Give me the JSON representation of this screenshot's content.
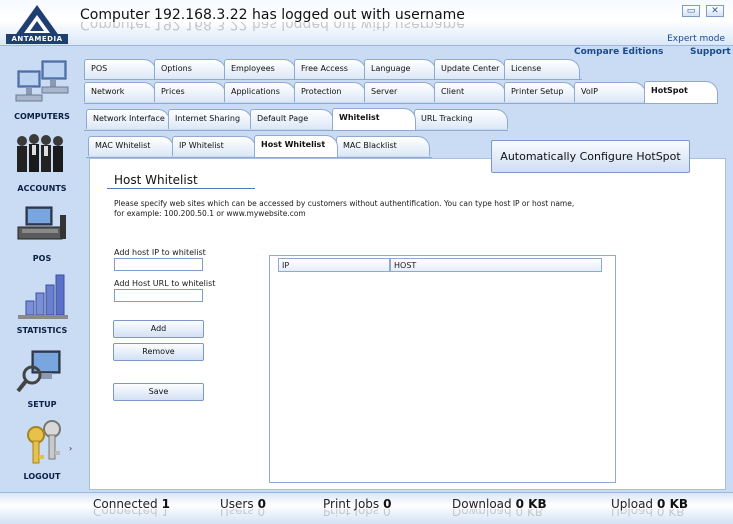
{
  "window": {
    "title": "Computer 192.168.3.22 has logged out with username",
    "logo_text": "ANTAMEDIA",
    "expert_mode": "Expert mode",
    "minimize_icon": "minimize-icon",
    "close_icon": "close-icon"
  },
  "top_links": {
    "compare": "Compare Editions",
    "support": "Support"
  },
  "sidebar": {
    "items": [
      {
        "label": "COMPUTERS",
        "icon": "computers-icon"
      },
      {
        "label": "ACCOUNTS",
        "icon": "accounts-icon"
      },
      {
        "label": "POS",
        "icon": "pos-icon"
      },
      {
        "label": "STATISTICS",
        "icon": "statistics-icon"
      },
      {
        "label": "SETUP",
        "icon": "setup-icon"
      },
      {
        "label": "LOGOUT",
        "icon": "logout-icon"
      }
    ]
  },
  "tabs": {
    "row1": [
      "POS",
      "Options",
      "Employees",
      "Free Access",
      "Language",
      "Update Center",
      "License"
    ],
    "row2": [
      "Network",
      "Prices",
      "Applications",
      "Protection",
      "Server",
      "Client",
      "Printer Setup",
      "VoIP",
      "HotSpot"
    ],
    "row3": [
      "Network Interface",
      "Internet Sharing",
      "Default Page",
      "Whitelist",
      "URL Tracking"
    ],
    "row4": [
      "MAC Whitelist",
      "IP Whitelist",
      "Host Whitelist",
      "MAC Blacklist"
    ]
  },
  "auto_config_button": "Automatically Configure HotSpot",
  "section": {
    "title": "Host Whitelist",
    "desc_line1": "Please specify web sites which can be accessed by customers without authentification. You can type host IP or host name,",
    "desc_line2": "for example:  100.200.50.1  or  www.mywebsite.com"
  },
  "form": {
    "ip_label": "Add host IP to whitelist",
    "ip_value": "",
    "url_label": "Add Host URL to whitelist",
    "url_value": "",
    "add_button": "Add",
    "remove_button": "Remove",
    "save_button": "Save"
  },
  "grid": {
    "columns": [
      "IP",
      "HOST"
    ],
    "rows": []
  },
  "status": {
    "connected_label": "Connected",
    "connected_value": "1",
    "users_label": "Users",
    "users_value": "0",
    "print_label": "Print Jobs",
    "print_value": "0",
    "download_label": "Download",
    "download_value": "0 KB",
    "upload_label": "Upload",
    "upload_value": "0 KB"
  }
}
